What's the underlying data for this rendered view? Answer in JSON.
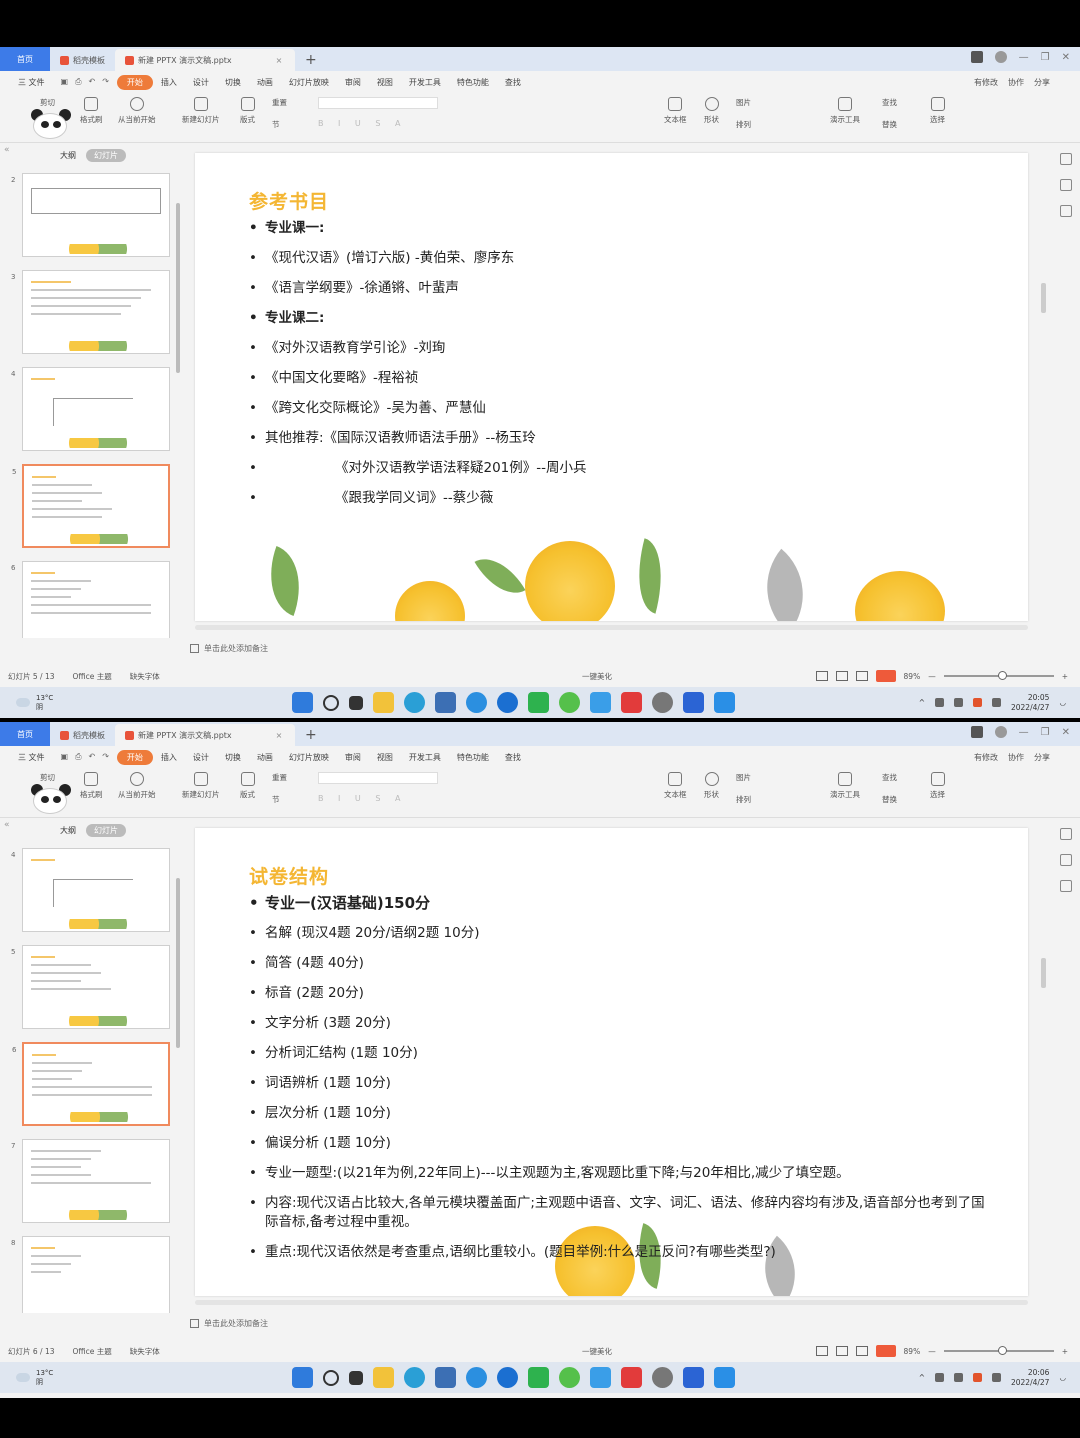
{
  "common": {
    "home_tab": "首页",
    "template_tab": "稻壳模板",
    "file_tab": "新建 PPTX 演示文稿.pptx",
    "menu": [
      "三 文件",
      "开始",
      "插入",
      "设计",
      "切换",
      "动画",
      "幻灯片放映",
      "审阅",
      "视图",
      "开发工具",
      "特色功能",
      "查找"
    ],
    "menu_right": [
      "有修改",
      "协作",
      "分享"
    ],
    "ribbon": {
      "cut": "剪切",
      "paste": "粘贴",
      "format_painter": "格式刷",
      "from_current": "从当前开始",
      "new_slide": "新建幻灯片",
      "layout": "版式",
      "reset": "重置",
      "section": "节",
      "textbox": "文本框",
      "shape": "形状",
      "picture": "图片",
      "arrange": "排列",
      "present_tools": "演示工具",
      "find": "查找",
      "replace": "替换",
      "select": "选择"
    },
    "panel_outline": "大纲",
    "panel_slides": "幻灯片",
    "add_notes": "单击此处添加备注",
    "theme": "Office 主题",
    "missing_font": "缺失字体",
    "beautify": "一键美化",
    "zoom": "89%",
    "weather_temp": "13°C",
    "weather_desc": "阴",
    "accent": "#f4b633"
  },
  "screen1": {
    "slide_counter": "幻灯片 5 / 13",
    "thumb_numbers": [
      "2",
      "3",
      "4",
      "5",
      "6"
    ],
    "selected_thumb": "5",
    "title": "参考书目",
    "bullets": [
      {
        "text": "专业课一:",
        "bold": true
      },
      {
        "text": "《现代汉语》(增订六版) -黄伯荣、廖序东",
        "bold": false
      },
      {
        "text": "《语言学纲要》-徐通锵、叶蜚声",
        "bold": false
      },
      {
        "text": "专业课二:",
        "bold": true
      },
      {
        "text": "《对外汉语教育学引论》-刘珣",
        "bold": false
      },
      {
        "text": "《中国文化要略》-程裕祯",
        "bold": false
      },
      {
        "text": "《跨文化交际概论》-吴为善、严慧仙",
        "bold": false
      },
      {
        "text": "其他推荐:《国际汉语教师语法手册》--杨玉玲",
        "bold": false
      },
      {
        "text": "《对外汉语教学语法释疑201例》--周小兵",
        "bold": false,
        "indent": true
      },
      {
        "text": "《跟我学同义词》--蔡少薇",
        "bold": false,
        "indent": true
      }
    ],
    "time": "20:05",
    "date": "2022/4/27"
  },
  "screen2": {
    "slide_counter": "幻灯片 6 / 13",
    "thumb_numbers": [
      "4",
      "5",
      "6",
      "7",
      "8"
    ],
    "selected_thumb": "6",
    "title": "试卷结构",
    "bullets": [
      {
        "text": "专业一(汉语基础)150分",
        "bold": true,
        "big": true
      },
      {
        "text": "名解 (现汉4题 20分/语纲2题 10分)"
      },
      {
        "text": "简答 (4题 40分)"
      },
      {
        "text": "标音 (2题 20分)"
      },
      {
        "text": "文字分析 (3题 20分)"
      },
      {
        "text": "分析词汇结构 (1题 10分)"
      },
      {
        "text": "词语辨析 (1题 10分)"
      },
      {
        "text": "层次分析 (1题 10分)"
      },
      {
        "text": "偏误分析 (1题 10分)"
      },
      {
        "text": "专业一题型:(以21年为例,22年同上)---以主观题为主,客观题比重下降;与20年相比,减少了填空题。"
      },
      {
        "text": "内容:现代汉语占比较大,各单元模块覆盖面广;主观题中语音、文字、词汇、语法、修辞内容均有涉及,语音部分也考到了国际音标,备考过程中重视。"
      },
      {
        "text": "重点:现代汉语依然是考查重点,语纲比重较小。(题目举例:什么是正反问?有哪些类型?)"
      }
    ],
    "time": "20:06",
    "date": "2022/4/27"
  }
}
